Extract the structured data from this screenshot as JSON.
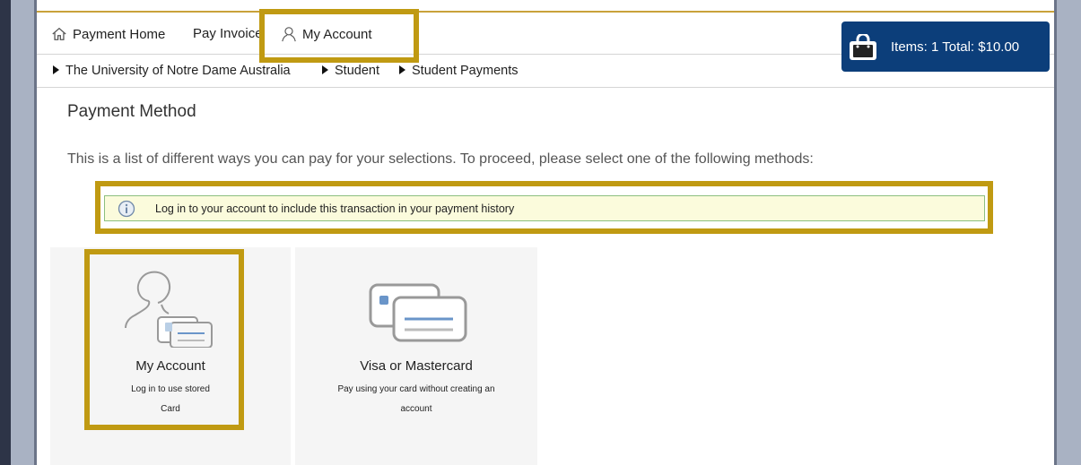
{
  "nav": {
    "home_label": "Payment Home",
    "pay_label": "Pay Invoice",
    "account_label": "My Account"
  },
  "cart": {
    "label": "Items: 1 Total: $10.00"
  },
  "breadcrumb": [
    "The University of Notre Dame Australia",
    "Student",
    "Student Payments"
  ],
  "main": {
    "title": "Payment Method",
    "intro": "This is a list of different ways you can pay for your selections. To proceed, please select one of the following methods:",
    "info": "Log in to your account to include this transaction in your payment history"
  },
  "methods": [
    {
      "title": "My Account",
      "subtitle_line1": "Log in to use stored",
      "subtitle_line2": "Card"
    },
    {
      "title": "Visa or Mastercard",
      "subtitle_line1": "Pay using your card without creating an",
      "subtitle_line2": "account"
    }
  ],
  "colors": {
    "cart_bg": "#0c3e7a",
    "highlight": "#c09a12",
    "info_bg": "#fbfbdc",
    "info_border": "#8cbf7f"
  }
}
